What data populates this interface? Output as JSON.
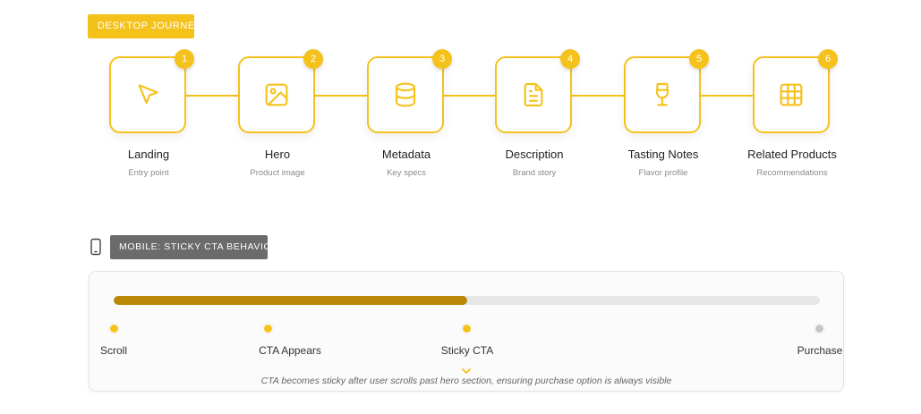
{
  "desktop_tag": "DESKTOP JOURNEY",
  "steps": [
    {
      "num": "1",
      "label": "Landing",
      "sub": "Entry point",
      "icon": "cursor-icon"
    },
    {
      "num": "2",
      "label": "Hero",
      "sub": "Product image",
      "icon": "image-icon"
    },
    {
      "num": "3",
      "label": "Metadata",
      "sub": "Key specs",
      "icon": "database-icon"
    },
    {
      "num": "4",
      "label": "Description",
      "sub": "Brand story",
      "icon": "document-icon"
    },
    {
      "num": "5",
      "label": "Tasting Notes",
      "sub": "Flavor profile",
      "icon": "wine-glass-icon"
    },
    {
      "num": "6",
      "label": "Related Products",
      "sub": "Recommendations",
      "icon": "grid-icon"
    }
  ],
  "mobile_tag": "MOBILE: STICKY CTA BEHAVIOR",
  "mobile_icon": "phone-icon",
  "progress": {
    "fraction": 0.5,
    "points": [
      {
        "label": "Scroll",
        "state": "active"
      },
      {
        "label": "CTA Appears",
        "state": "active"
      },
      {
        "label": "Sticky CTA",
        "state": "active"
      },
      {
        "label": "Purchase",
        "state": "inactive"
      }
    ]
  },
  "caption": "CTA becomes sticky after user scrolls past hero section, ensuring purchase option is always visible",
  "colors": {
    "accent": "#f5c21b",
    "progress_fill": "#b98804",
    "mobile_tag_bg": "#6b6b6b"
  }
}
